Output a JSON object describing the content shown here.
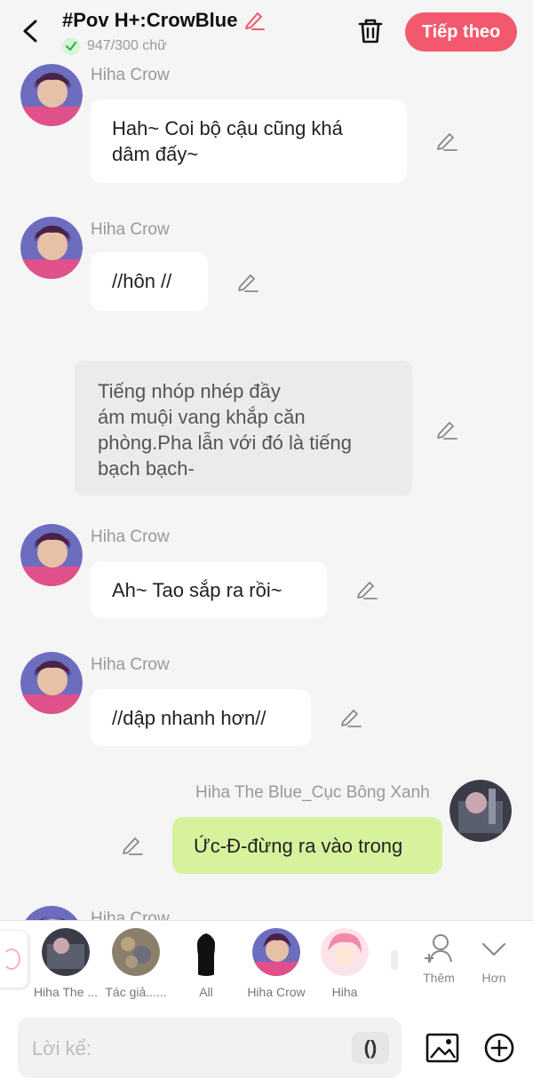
{
  "header": {
    "title": "#Pov H+:CrowBlue",
    "word_count": "947/300 chữ",
    "next_label": "Tiếp theo",
    "accent_color": "#f2596e"
  },
  "messages": [
    {
      "type": "char",
      "name": "Hiha Crow",
      "text_lines": [
        "Hah~ Coi bộ cậu cũng khá",
        "dâm đấy~"
      ]
    },
    {
      "type": "char",
      "name": "Hiha Crow",
      "text_lines": [
        "//hôn //"
      ]
    },
    {
      "type": "narration",
      "text_lines": [
        "Tiếng nhóp nhép đầy",
        "ám muội vang khắp căn",
        "phòng.Pha lẫn với đó là tiếng",
        "bạch bạch-"
      ]
    },
    {
      "type": "char",
      "name": "Hiha Crow",
      "text_lines": [
        "Ah~ Tao sắp ra rồi~"
      ]
    },
    {
      "type": "char",
      "name": "Hiha Crow",
      "text_lines": [
        "//dập nhanh hơn//"
      ]
    },
    {
      "type": "self",
      "name": "Hiha The Blue_Cục Bông Xanh",
      "text_lines": [
        "Ức-Đ-đừng ra vào trong"
      ]
    },
    {
      "type": "char",
      "name": "Hiha Crow",
      "text_lines": []
    }
  ],
  "characters": [
    {
      "label": "Hiha The ...",
      "icon": "avatar-blue-hair"
    },
    {
      "label": "Tác giả......",
      "icon": "avatar-author"
    },
    {
      "label": "All",
      "icon": "avatar-silhouette"
    },
    {
      "label": "Hiha Crow",
      "icon": "avatar-crow"
    },
    {
      "label": "Hiha",
      "icon": "avatar-pink-hair"
    }
  ],
  "tools": {
    "add_label": "Thêm",
    "more_label": "Hơn"
  },
  "input": {
    "placeholder": "Lời kể:",
    "paren_label": "()"
  }
}
